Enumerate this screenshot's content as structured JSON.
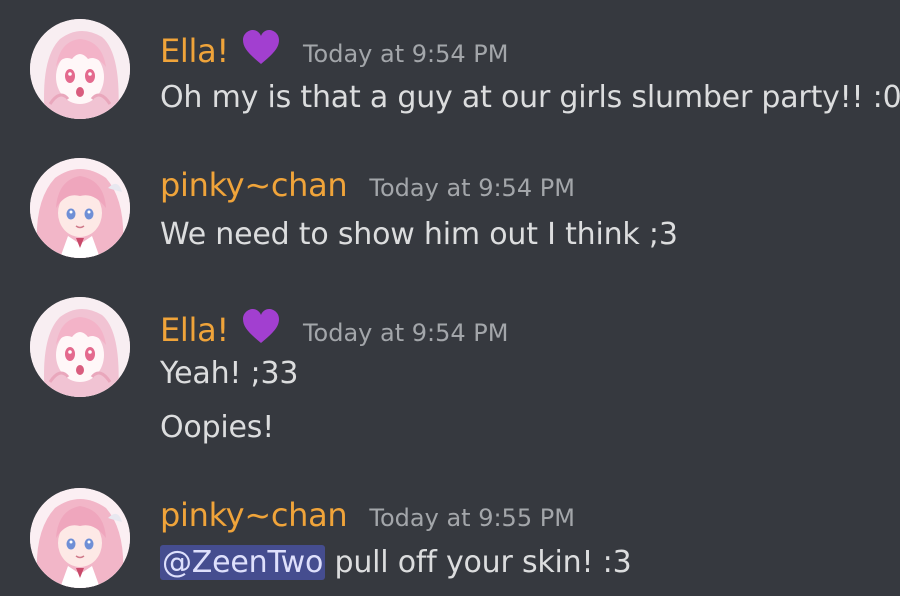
{
  "messages": [
    {
      "author": "Ella!",
      "badge_icon": "purple-heart-icon",
      "timestamp": "Today at 9:54 PM",
      "lines": [
        "Oh my is that a guy at our girls slumber party!! :0"
      ]
    },
    {
      "author": "pinky~chan",
      "timestamp": "Today at 9:54 PM",
      "lines": [
        "We need to show him out I think ;3"
      ]
    },
    {
      "author": "Ella!",
      "badge_icon": "purple-heart-icon",
      "timestamp": "Today at 9:54 PM",
      "lines": [
        "Yeah! ;33",
        "Oopies!"
      ]
    },
    {
      "author": "pinky~chan",
      "timestamp": "Today at 9:55 PM",
      "mention": "@ZeenTwo",
      "lines": [
        " pull off your skin! :3"
      ]
    }
  ],
  "colors": {
    "background": "#36393f",
    "username": "#f0a43a",
    "timestamp": "#a3a6aa",
    "text": "#dcddde",
    "mention_bg": "#5865f2",
    "heart": "#a23fd0"
  }
}
